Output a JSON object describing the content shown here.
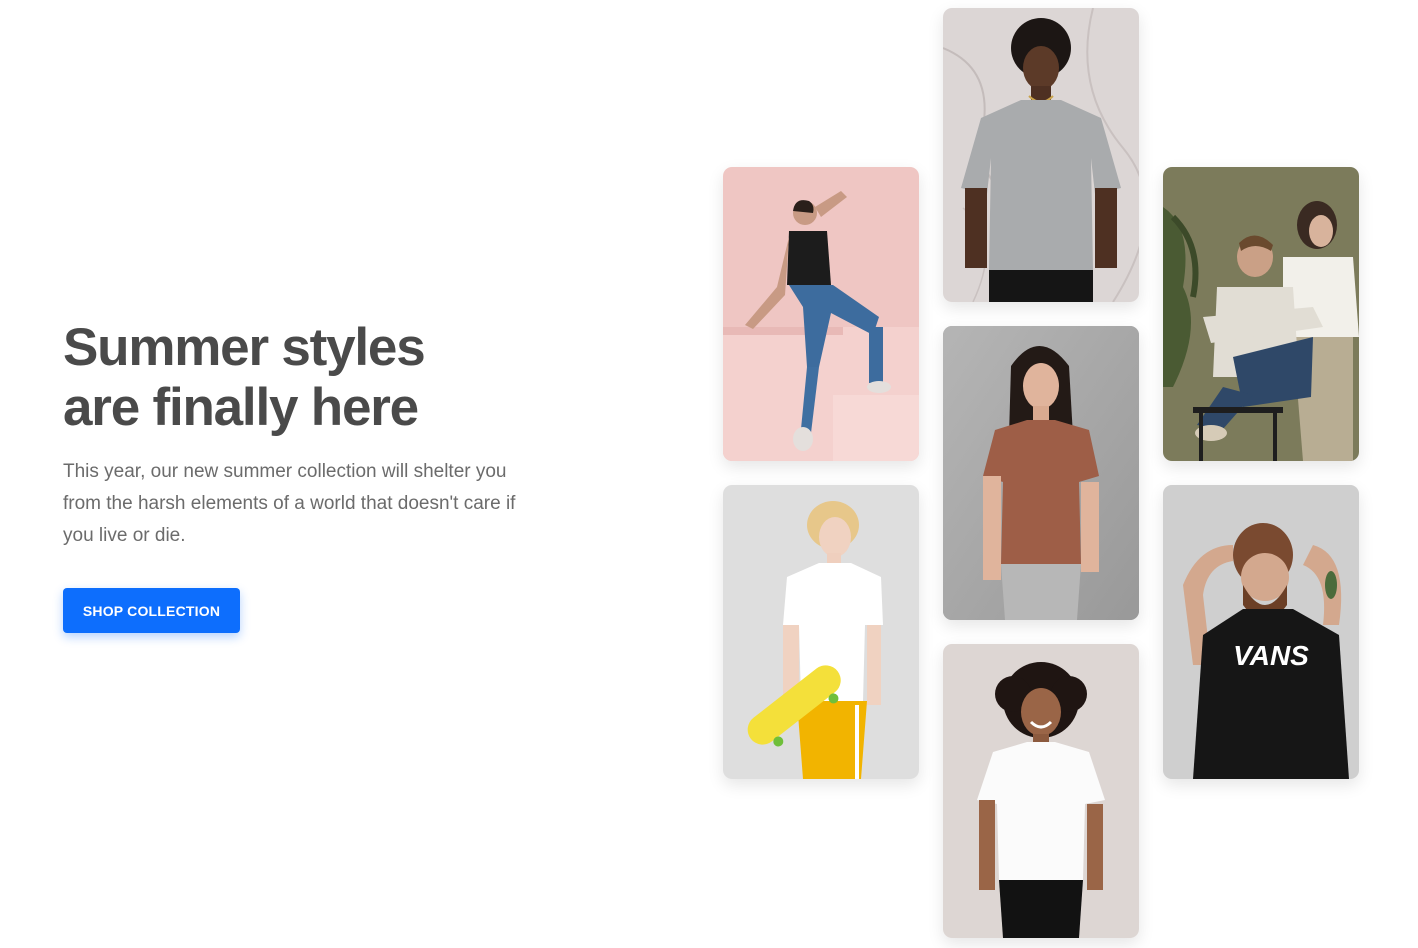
{
  "hero": {
    "headline_line1": "Summer styles",
    "headline_line2": "are finally here",
    "subtext": "This year, our new summer collection will shelter you from the harsh elements of a world that doesn't care if you live or die.",
    "cta_label": "SHOP COLLECTION"
  },
  "colors": {
    "accent": "#0d6efd",
    "headline": "#4a4a4a",
    "body_text": "#6b6b6b"
  },
  "gallery": {
    "tiles": [
      {
        "name": "woman-black-tee-pink-wall-photo",
        "bg": "#efc8c6"
      },
      {
        "name": "man-grey-tee-marble-photo",
        "bg": "#d9d4d3"
      },
      {
        "name": "couple-sitting-olive-photo",
        "bg": "#7b7a5c"
      },
      {
        "name": "teen-skateboard-yellow-pants-photo",
        "bg": "#dcdcdc"
      },
      {
        "name": "woman-brown-tee-grey-wall-photo",
        "bg": "#a8a8a8"
      },
      {
        "name": "bearded-man-vans-tee-photo",
        "bg": "#cfcfcf"
      },
      {
        "name": "woman-white-tee-curly-hair-photo",
        "bg": "#dcd6d3"
      }
    ],
    "vans_logo_text": "VANS"
  }
}
